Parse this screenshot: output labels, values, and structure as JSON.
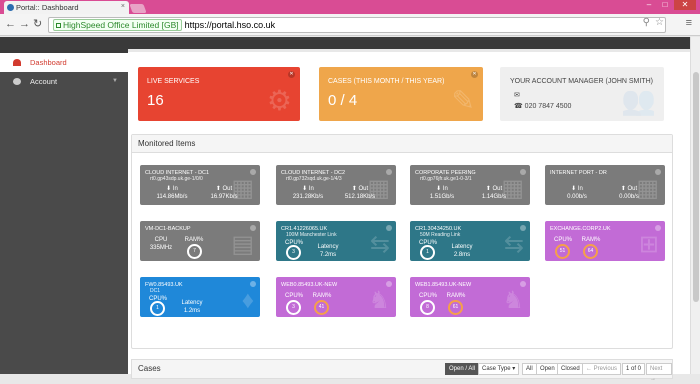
{
  "browser": {
    "tab_title": "Portal:: Dashboard",
    "tab_close": "×",
    "ev_label": "HighSpeed Office Limited [GB]",
    "url": "https://portal.hso.co.uk"
  },
  "sidebar": {
    "items": [
      {
        "label": "Dashboard",
        "active": true,
        "icon": "dashboard-icon"
      },
      {
        "label": "Account",
        "active": false,
        "icon": "user-icon"
      }
    ]
  },
  "stats": {
    "live_services_label": "Live Services",
    "live_services_value": "16",
    "cases_label": "Cases (This Month / This Year)",
    "cases_value": "0 / 4",
    "manager_label": "Your Account Manager (John Smith)",
    "manager_phone": "020 7847 4500"
  },
  "monitored": {
    "title": "Monitored Items",
    "cards": [
      {
        "title": "Cloud Internet - DC1",
        "sub": "rt0.gp43sdp.uk.ge-1/0/0",
        "in_label": "In",
        "in": "114.86Mb/s",
        "out_label": "Out",
        "out": "16.97Kb/s",
        "color": "grey"
      },
      {
        "title": "Cloud Internet - DC2",
        "sub": "rt0.gp732sqd.uk.ge-1/4/3",
        "in_label": "In",
        "in": "231.28Kb/s",
        "out_label": "Out",
        "out": "512.18Kb/s",
        "color": "grey"
      },
      {
        "title": "Corporate Peering",
        "sub": "rt0.gp76jfr.uk.ge1-0-3/1",
        "in_label": "In",
        "in": "1.51Gb/s",
        "out_label": "Out",
        "out": "1.14Gb/s",
        "color": "grey"
      },
      {
        "title": "Internet Port - DR",
        "sub": "",
        "in_label": "In",
        "in": "0.00b/s",
        "out_label": "Out",
        "out": "0.00b/s",
        "color": "grey"
      },
      {
        "title": "VM-DC1-BACKUP",
        "cpu_label": "CPU",
        "cpu": "335MHz",
        "ram_label": "RAM%",
        "ram": "7",
        "color": "grey"
      },
      {
        "title": "CR1.41226065.UK",
        "sub": "100M Manchester Link",
        "cpu_label": "CPU%",
        "cpu": "3",
        "lat_label": "Latency",
        "lat": "7.2ms",
        "color": "teal"
      },
      {
        "title": "CR1.30434250.UK",
        "sub": "50M Reading Link",
        "cpu_label": "CPU%",
        "cpu": "1",
        "lat_label": "Latency",
        "lat": "2.8ms",
        "color": "teal"
      },
      {
        "title": "EXCHANGE.CORP2.UK",
        "cpu_label": "CPU%",
        "cpu": "51",
        "ram_label": "RAM%",
        "ram": "64",
        "color": "purple"
      },
      {
        "title": "FW0.85493.UK",
        "sub": "DC1",
        "cpu_label": "CPU%",
        "cpu": "1",
        "lat_label": "Latency",
        "lat": "1.2ms",
        "color": "blue"
      },
      {
        "title": "WEB0.85493.UK-NEW",
        "cpu_label": "CPU%",
        "cpu": "3",
        "ram_label": "RAM%",
        "ram": "41",
        "color": "purple"
      },
      {
        "title": "WEB1.85493.UK-NEW",
        "cpu_label": "CPU%",
        "cpu": "8",
        "ram_label": "RAM%",
        "ram": "61",
        "color": "purple"
      }
    ]
  },
  "cases": {
    "title": "Cases",
    "open_all": "Open / All",
    "case_type": "Case Type",
    "all": "All",
    "open": "Open",
    "closed": "Closed",
    "previous": "← Previous",
    "page": "1 of 0",
    "next": "Next →"
  }
}
